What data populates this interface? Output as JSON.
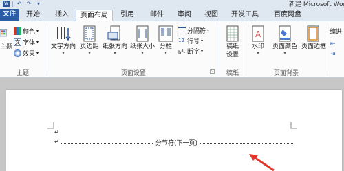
{
  "titlebar": {
    "title": "新建 Microsoft Word 文",
    "qat": [
      {
        "icon": "undo-icon",
        "glyph": "↶"
      },
      {
        "icon": "redo-icon",
        "glyph": "↷"
      },
      {
        "icon": "customize-icon",
        "glyph": "▾"
      }
    ]
  },
  "tabs": {
    "file": "文件",
    "items": [
      "开始",
      "插入",
      "页面布局",
      "引用",
      "邮件",
      "审阅",
      "视图",
      "开发工具",
      "百度网盘"
    ]
  },
  "ribbon": {
    "theme_group": {
      "label": "主题",
      "big_label": "主题",
      "colors": "颜色",
      "fonts": "字体",
      "effects": "效果"
    },
    "page_setup": {
      "label": "页面设置",
      "text_direction": "文字方向",
      "margins": "页边距",
      "orientation": "纸张方向",
      "size": "纸张大小",
      "columns": "分栏",
      "breaks": "分隔符",
      "line_numbers": "行号",
      "hyphenation": "断字"
    },
    "manuscript": {
      "label": "稿纸",
      "line1": "稿纸",
      "line2": "设置"
    },
    "page_background": {
      "label": "页面背景",
      "watermark": "水印",
      "page_color": "页面颜色",
      "page_borders": "页面边框"
    },
    "paragraph_partial": {
      "indent": "缩进",
      "l1": "⇤",
      "l2": "⇥"
    }
  },
  "document": {
    "paragraph_mark": "↵",
    "section_break": "分节符(下一页)"
  },
  "colors": {
    "file_tab": "#2a5ca8",
    "accent": "#2a5699",
    "arrow": "#e0392b"
  }
}
